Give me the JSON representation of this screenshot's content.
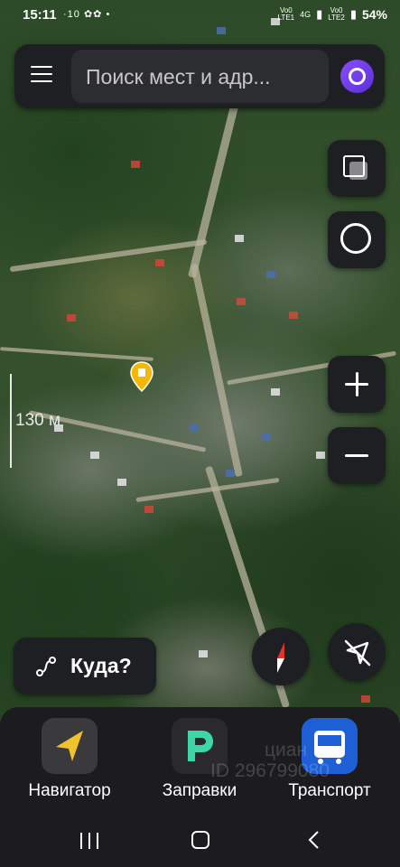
{
  "status_bar": {
    "time": "15:11",
    "notifications": "·10",
    "sim1_label": "LTE1",
    "sim2_label": "LTE2",
    "network": "4G",
    "battery": "54%"
  },
  "search": {
    "placeholder": "Поиск мест и адр...",
    "menu_icon": "hamburger-icon",
    "assistant_icon": "alice-icon"
  },
  "map": {
    "scale_label": "130 м",
    "colors": {
      "accent_pin": "#f5b800",
      "assistant": "#7a3cff"
    }
  },
  "controls": {
    "layers_icon": "layers-icon",
    "camera_icon": "circle-icon",
    "zoom_in_icon": "plus-icon",
    "zoom_out_icon": "minus-icon",
    "compass_icon": "compass-icon",
    "location_icon": "location-off-icon"
  },
  "where_to": {
    "label": "Куда?"
  },
  "dock": {
    "items": [
      {
        "label": "Навигатор",
        "icon": "navigator-icon"
      },
      {
        "label": "Заправки",
        "icon": "fuel-icon"
      },
      {
        "label": "Транспорт",
        "icon": "bus-icon"
      }
    ]
  },
  "watermark": {
    "line1": "циан",
    "line2": "ID 296799080"
  }
}
